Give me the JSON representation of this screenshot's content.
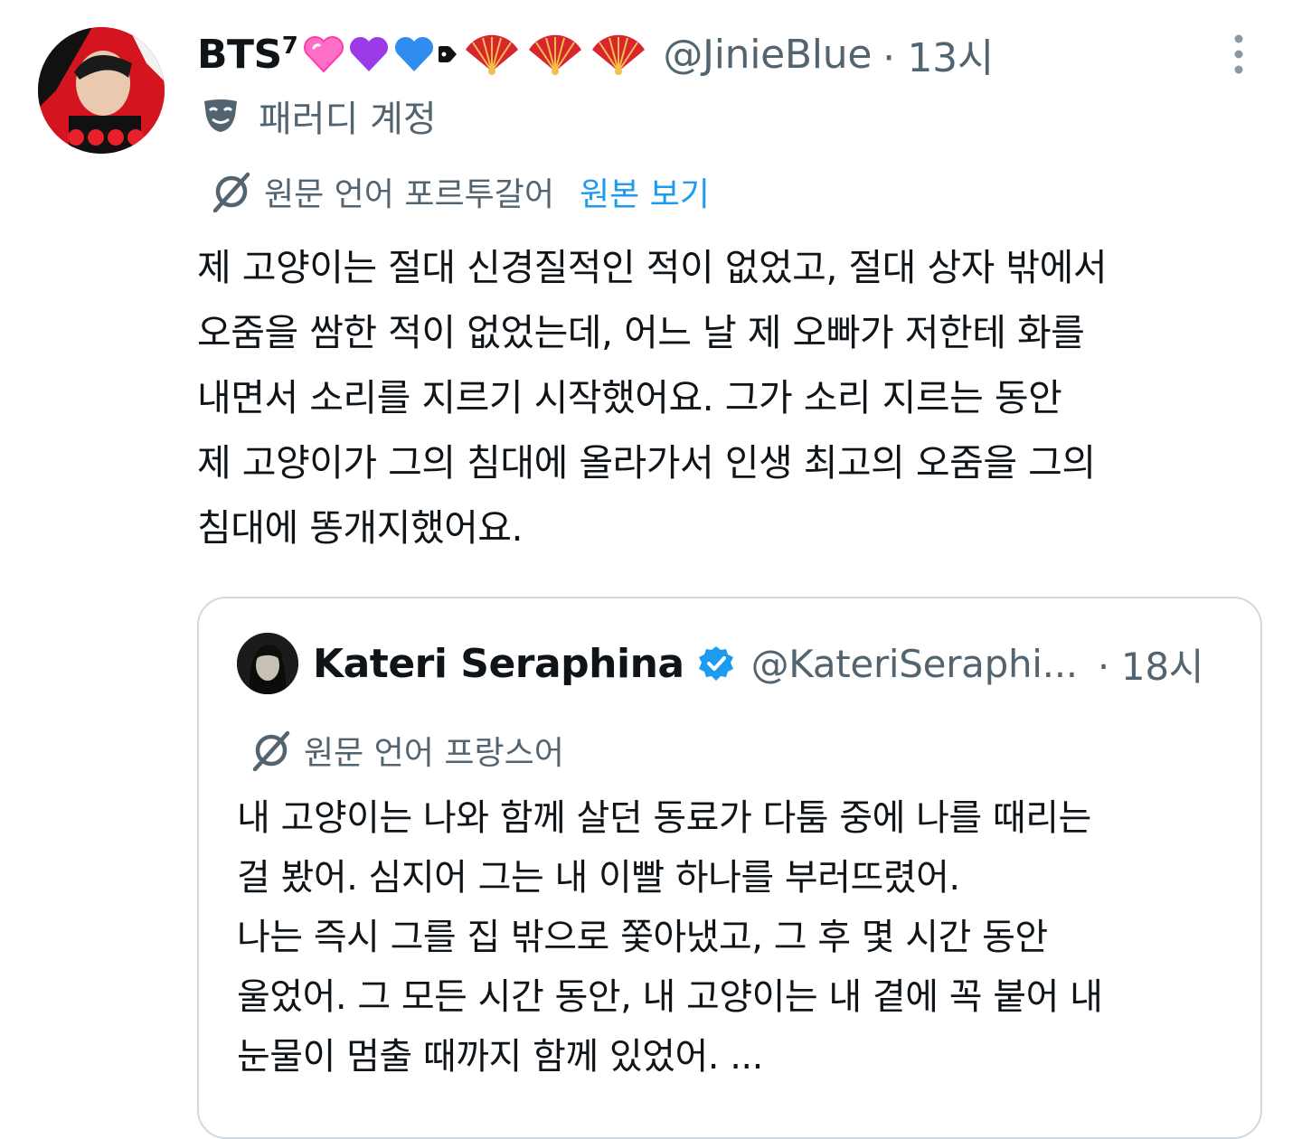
{
  "tweet": {
    "author": {
      "name": "BTS",
      "name_sup": "7",
      "emoji_icons": [
        "pink-heart-icon",
        "purple-heart-icon",
        "blue-heart-icon",
        "tag-icon",
        "folding-fan-icon",
        "folding-fan-icon",
        "folding-fan-icon"
      ],
      "handle": "@JinieBlue",
      "time": "· 13시"
    },
    "parody_label": "패러디 계정",
    "translation": {
      "original_language": "원문 언어 포르투갈어",
      "view_original": "원본 보기"
    },
    "text": "제 고양이는 절대 신경질적인 적이 없었고, 절대 상자 밖에서\n오줌을 쌈한 적이 없었는데, 어느 날 제 오빠가 저한테 화를\n내면서 소리를 지르기 시작했어요. 그가 소리 지르는 동안\n제 고양이가 그의 침대에 올라가서 인생 최고의 오줌을 그의\n침대에 똥개지했어요.",
    "quoted": {
      "author": {
        "name": "Kateri Seraphina",
        "handle": "@KateriSeraphi...",
        "time": "· 18시",
        "verified": true
      },
      "translation": {
        "original_language": "원문 언어 프랑스어"
      },
      "text": "내 고양이는 나와 함께 살던 동료가 다툼 중에 나를 때리는\n걸 봤어. 심지어 그는 내 이빨 하나를 부러뜨렸어.\n나는 즉시 그를 집 밖으로 쫓아냈고, 그 후 몇 시간 동안\n울었어. 그 모든 시간 동안, 내 고양이는 내 곁에 꼭 붙어 내\n눈물이 멈출 때까지 함께 있었어.  ..."
    }
  },
  "colors": {
    "text": "#0f1419",
    "secondary": "#536471",
    "link": "#1d9bf0",
    "border": "#cfd9de",
    "verified": "#1d9bf0"
  }
}
